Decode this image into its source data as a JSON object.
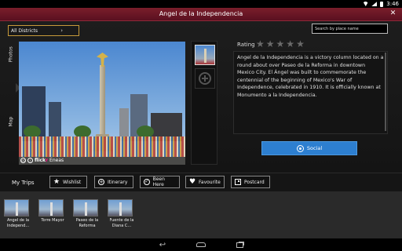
{
  "status_bar": {
    "time": "3:46"
  },
  "window": {
    "title": "Angel de la Independencia",
    "close_glyph": "✕"
  },
  "filters": {
    "district_label": "All Districts",
    "district_chevron": "›",
    "search_placeholder": "Search by place name"
  },
  "side_tabs": {
    "photos": "Photos",
    "map": "Map"
  },
  "photo": {
    "credit_name": "Eneas",
    "flickr_prefix": "flick",
    "flickr_suffix": "r"
  },
  "rating": {
    "label": "Rating",
    "stars_filled": 0,
    "stars_total": 5
  },
  "description": "Angel de la Independencia is a victory column located on a round about over Paseo de la Reforma in downtown Mexico City. El Ángel was built to commemorate the centennial of the beginning of Mexico's War of Independence, celebrated in 1910. It is officially known at Monumento a la Independencia.",
  "social_label": "Social",
  "trips": {
    "label": "My Trips",
    "buttons": {
      "wishlist": "Wishlist",
      "itinerary": "Itinerary",
      "been_here": "Been Here",
      "favourite": "Favourite",
      "postcard": "Postcard"
    }
  },
  "strip": {
    "items": [
      "Angel de la Independ...",
      "Torre Mayor",
      "Paseo de la Reforma",
      "Fuente de la Diana C..."
    ]
  },
  "colors": {
    "title_bar": "#6b1626",
    "social_button": "#2d7fd0",
    "district_border": "#c79a3a"
  }
}
